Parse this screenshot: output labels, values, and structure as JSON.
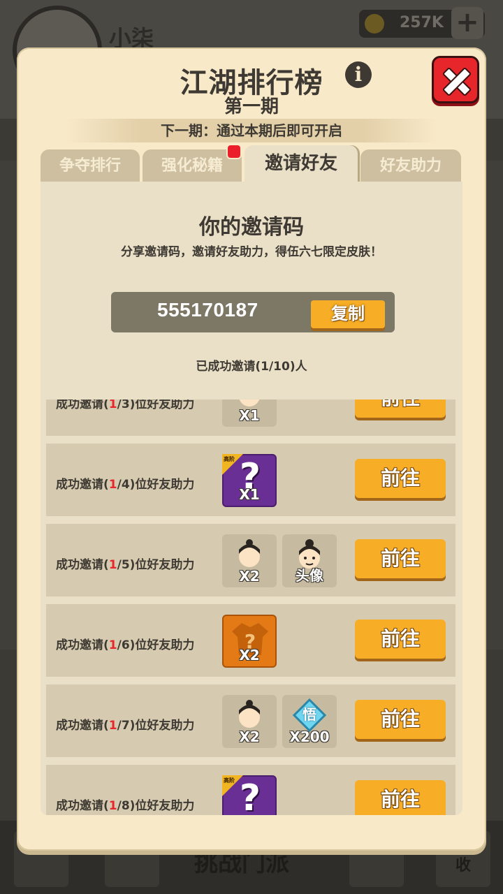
{
  "background": {
    "player_name": "小柒",
    "coins": "257K",
    "bottom_button": "挑战门派",
    "bottom_slot_text": "收"
  },
  "modal": {
    "title": "江湖排行榜",
    "issue": "第一期",
    "next_issue_banner": "下一期：通过本期后即可开启",
    "tabs": [
      {
        "label": "争夺排行",
        "active": false
      },
      {
        "label": "强化秘籍",
        "active": false,
        "has_notification": true
      },
      {
        "label": "邀请好友",
        "active": true
      },
      {
        "label": "好友助力",
        "active": false
      }
    ]
  },
  "invite": {
    "heading": "你的邀请码",
    "description": "分享邀请码，邀请好友助力，得伍六七限定皮肤！",
    "code": "555170187",
    "copy_label": "复制",
    "progress_text": "已成功邀请(1/10)人"
  },
  "tasks": [
    {
      "prefix": "成功邀请(",
      "current": "1",
      "target": "/3)位好友助力",
      "rewards": [
        {
          "kind": "character",
          "qty": "X1"
        }
      ],
      "button": "前往"
    },
    {
      "prefix": "成功邀请(",
      "current": "1",
      "target": "/4)位好友助力",
      "rewards": [
        {
          "kind": "mystery-purple",
          "qty": "X1",
          "badge": "高阶"
        }
      ],
      "button": "前往"
    },
    {
      "prefix": "成功邀请(",
      "current": "1",
      "target": "/5)位好友助力",
      "rewards": [
        {
          "kind": "character",
          "qty": "X2"
        },
        {
          "kind": "avatar",
          "qty": "头像"
        }
      ],
      "button": "前往"
    },
    {
      "prefix": "成功邀请(",
      "current": "1",
      "target": "/6)位好友助力",
      "rewards": [
        {
          "kind": "mystery-orange",
          "qty": "X2"
        }
      ],
      "button": "前往"
    },
    {
      "prefix": "成功邀请(",
      "current": "1",
      "target": "/7)位好友助力",
      "rewards": [
        {
          "kind": "character",
          "qty": "X2"
        },
        {
          "kind": "gem",
          "qty": "X200",
          "gem_text": "悟"
        }
      ],
      "button": "前往"
    },
    {
      "prefix": "成功邀请(",
      "current": "1",
      "target": "/8)位好友助力",
      "rewards": [
        {
          "kind": "mystery-purple",
          "qty": "",
          "badge": "高阶"
        }
      ],
      "button": "前往"
    }
  ],
  "colors": {
    "accent_button": "#f7ae26",
    "highlight_number": "#e6272d",
    "close_button": "#e6262b",
    "modal_bg": "#f8e9c9"
  }
}
